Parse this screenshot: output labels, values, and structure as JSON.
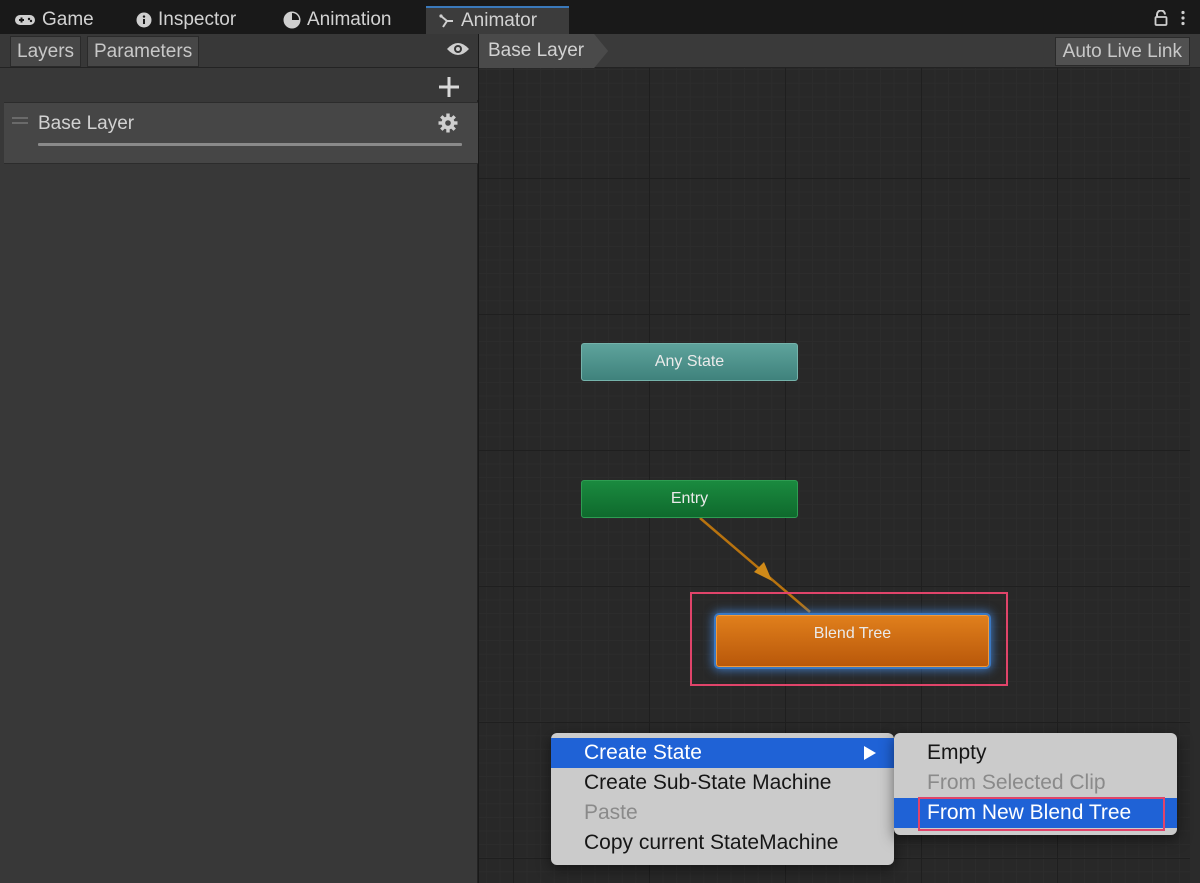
{
  "tabs": [
    {
      "label": "Game",
      "icon": "gamepad-icon"
    },
    {
      "label": "Inspector",
      "icon": "info-icon"
    },
    {
      "label": "Animation",
      "icon": "clock-icon"
    },
    {
      "label": "Animator",
      "icon": "animator-icon",
      "active": true
    }
  ],
  "left_panel": {
    "subtabs": [
      "Layers",
      "Parameters"
    ],
    "layers": [
      {
        "name": "Base Layer"
      }
    ]
  },
  "graph": {
    "breadcrumb": "Base Layer",
    "auto_live_link": "Auto Live Link",
    "nodes": {
      "any_state": "Any State",
      "entry": "Entry",
      "blend_tree": "Blend Tree"
    }
  },
  "context_menu": {
    "items": [
      {
        "label": "Create State",
        "state": "selected",
        "has_submenu": true
      },
      {
        "label": "Create Sub-State Machine",
        "state": "normal"
      },
      {
        "label": "Paste",
        "state": "disabled"
      },
      {
        "label": "Copy current StateMachine",
        "state": "normal"
      }
    ],
    "submenu": [
      {
        "label": "Empty",
        "state": "normal"
      },
      {
        "label": "From Selected Clip",
        "state": "disabled"
      },
      {
        "label": "From New Blend Tree",
        "state": "selected"
      }
    ]
  },
  "colors": {
    "accent": "#1f62d6",
    "highlight_outline": "#e0446a",
    "any_state": "#4f938c",
    "entry": "#157a36",
    "blend_tree": "#cf6b13",
    "transition_arrow": "#b8730f"
  }
}
